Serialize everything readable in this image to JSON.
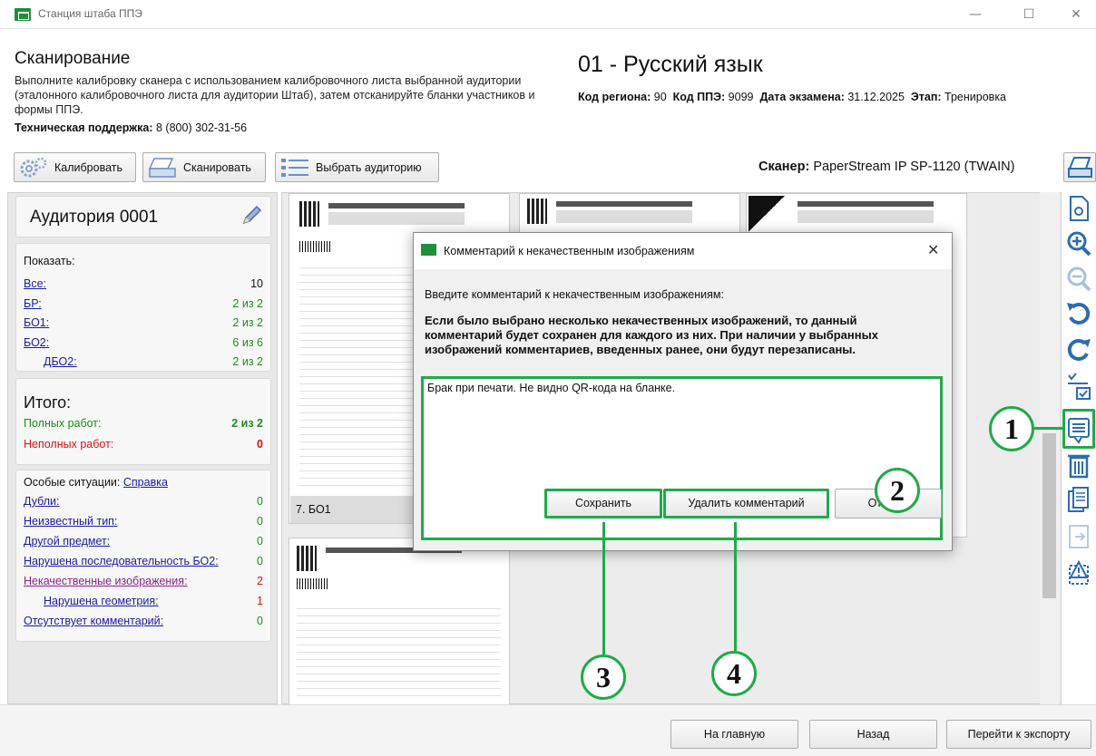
{
  "window": {
    "title": "Станция штаба ППЭ",
    "minimize": "—",
    "maximize": "☐",
    "close": "✕"
  },
  "header": {
    "heading": "Сканирование",
    "description": "Выполните калибровку сканера с использованием калибровочного листа выбранной аудитории (эталонного калибровочного листа для аудитории Штаб), затем отсканируйте бланки участников и формы ППЭ.",
    "support_label": "Техническая поддержка:",
    "support_phone": "8 (800) 302-31-56",
    "subject": "01 - Русский язык",
    "region_label": "Код региона:",
    "region": "90",
    "ppe_label": "Код ППЭ:",
    "ppe": "9099",
    "date_label": "Дата экзамена:",
    "date": "31.12.2025",
    "stage_label": "Этап:",
    "stage": "Тренировка"
  },
  "toolbar": {
    "calibrate": "Калибровать",
    "scan": "Сканировать",
    "select_auditorium": "Выбрать аудиторию",
    "scanner_label": "Сканер:",
    "scanner_name": "PaperStream IP SP-1120 (TWAIN)"
  },
  "left_panel": {
    "auditorium": "Аудитория 0001",
    "show_label": "Показать:",
    "filters": [
      {
        "label": "Все:",
        "value": "10"
      },
      {
        "label": "БР:",
        "value": "2 из 2"
      },
      {
        "label": "БО1:",
        "value": "2 из 2"
      },
      {
        "label": "БО2:",
        "value": "6 из 6"
      },
      {
        "label": "ДБО2:",
        "value": "2 из 2"
      }
    ],
    "totals_title": "Итого:",
    "full_label": "Полных работ:",
    "full_value": "2 из 2",
    "partial_label": "Неполных работ:",
    "partial_value": "0",
    "special_label": "Особые ситуации:",
    "help_link": "Справка",
    "special": [
      {
        "label": "Дубли:",
        "value": "0"
      },
      {
        "label": "Неизвестный тип:",
        "value": "0"
      },
      {
        "label": "Другой предмет:",
        "value": "0"
      },
      {
        "label": "Нарушена последовательность БО2:",
        "value": "0"
      },
      {
        "label": "Некачественные изображения:",
        "value": "2"
      },
      {
        "label": "Нарушена геометрия:",
        "value": "1"
      },
      {
        "label": "Отсутствует комментарий:",
        "value": "0"
      }
    ]
  },
  "thumbnails": {
    "caption_1": "7. БО1"
  },
  "dialog": {
    "title": "Комментарий к некачественным изображениям",
    "close": "✕",
    "prompt": "Введите комментарий к некачественным изображениям:",
    "warning": "Если было выбрано несколько некачественных изображений, то данный комментарий будет сохранен для каждого из них. При наличии у выбранных изображений комментариев, введенных ранее, они будут перезаписаны.",
    "comment": "Брак при печати. Не видно QR-кода на бланке.",
    "save": "Сохранить",
    "delete_comment": "Удалить комментарий",
    "cancel": "Отмена"
  },
  "bottom": {
    "home": "На главную",
    "back": "Назад",
    "export": "Перейти к экспорту"
  },
  "callouts": [
    "1",
    "2",
    "3",
    "4"
  ],
  "colors": {
    "highlight": "#1faa4a",
    "link": "#1a1aa6",
    "visited_link": "#8b1f8b",
    "accent_green": "#1f8a1f",
    "error_red": "#dd1111",
    "icon_blue": "#2b6cb0"
  },
  "icons": [
    "app-logo-icon",
    "gears-icon",
    "scanner-icon",
    "list-icon",
    "pencil-icon",
    "scanner-settings-icon",
    "view-icon",
    "zoom-in-icon",
    "zoom-out-icon",
    "rotate-left-icon",
    "rotate-right-icon",
    "mark-icon",
    "comment-icon",
    "trash-icon",
    "copy-icon",
    "export-icon",
    "warning-icon"
  ]
}
